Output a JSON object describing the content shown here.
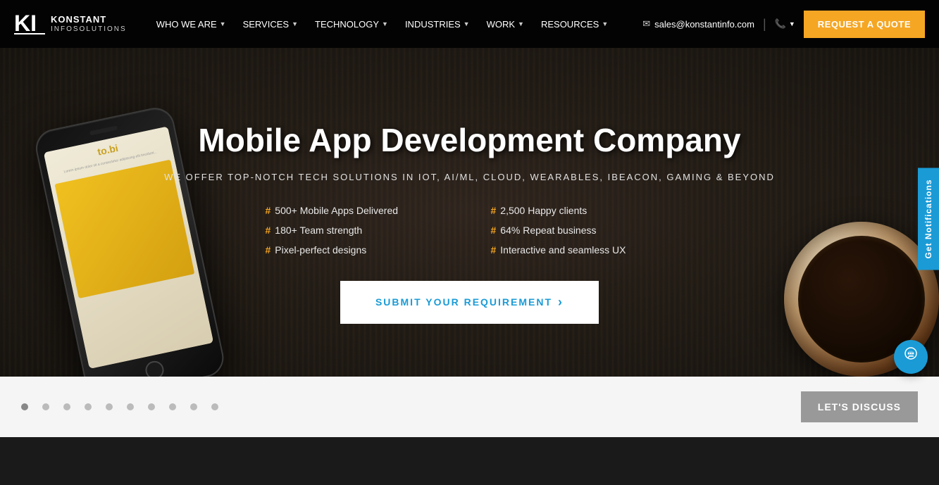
{
  "header": {
    "logo": {
      "brand": "KONSTANT",
      "tagline": "INFOSOLUTIONS"
    },
    "contact": {
      "email": "sales@konstantinfo.com",
      "phone_icon": "📞"
    },
    "nav": {
      "items": [
        {
          "label": "WHO WE ARE",
          "has_dropdown": true
        },
        {
          "label": "SERVICES",
          "has_dropdown": true
        },
        {
          "label": "TECHNOLOGY",
          "has_dropdown": true
        },
        {
          "label": "INDUSTRIES",
          "has_dropdown": true
        },
        {
          "label": "WORK",
          "has_dropdown": true
        },
        {
          "label": "RESOURCES",
          "has_dropdown": true
        }
      ]
    },
    "cta_button": "REQUEST A QUOTE"
  },
  "hero": {
    "title": "Mobile App Development Company",
    "subtitle": "WE OFFER TOP-NOTCH TECH SOLUTIONS IN IOT, AI/ML, CLOUD, WEARABLES, IBEACON, GAMING & BEYOND",
    "stats": [
      {
        "hash": "#",
        "text": "500+ Mobile Apps Delivered"
      },
      {
        "hash": "#",
        "text": "2,500 Happy clients"
      },
      {
        "hash": "#",
        "text": "180+ Team strength"
      },
      {
        "hash": "#",
        "text": "64% Repeat business"
      },
      {
        "hash": "#",
        "text": "Pixel-perfect designs"
      },
      {
        "hash": "#",
        "text": "Interactive and seamless UX"
      }
    ],
    "cta_button": "SUBMIT YOUR REQUIREMENT",
    "cta_arrow": "›"
  },
  "bottom_bar": {
    "dots": [
      1,
      2,
      3,
      4,
      5,
      6,
      7,
      8,
      9,
      10
    ],
    "active_dot": 1,
    "discuss_button": "LET'S DISCUSS"
  },
  "sidebar": {
    "notification_tab": "Get Notifications"
  },
  "chat": {
    "icon": "💬"
  }
}
